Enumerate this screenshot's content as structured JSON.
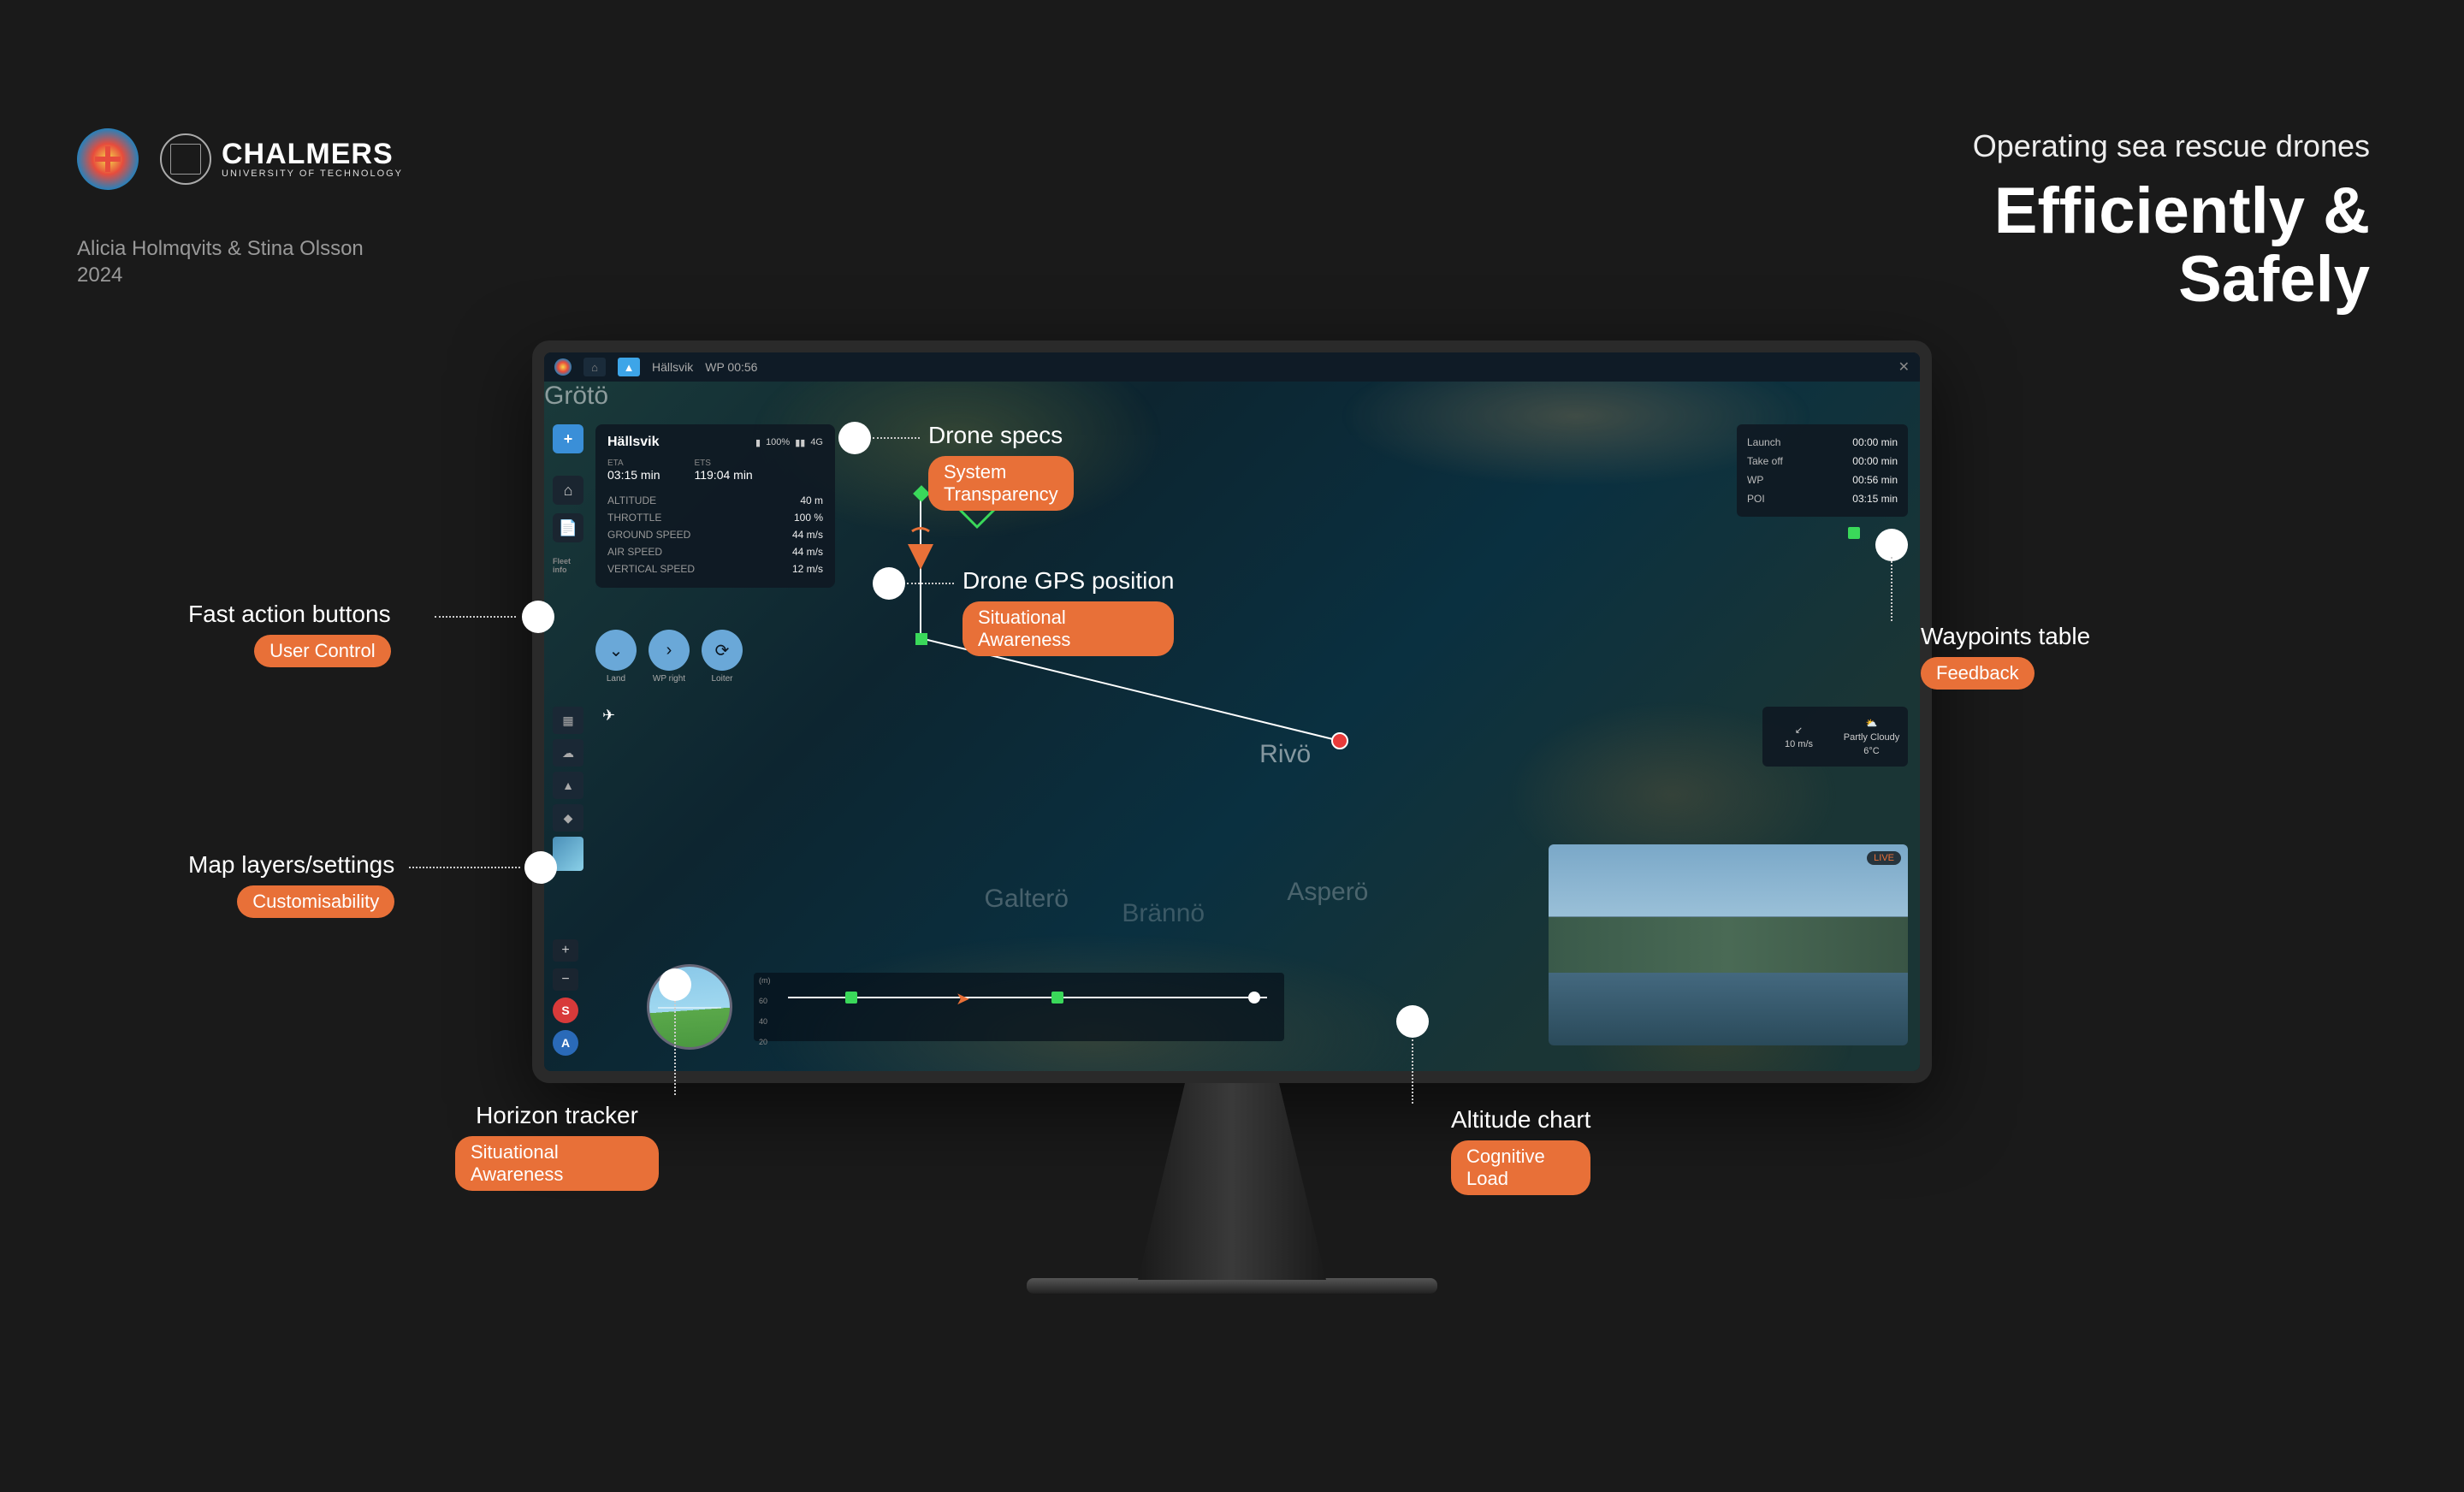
{
  "header": {
    "chalmers": "CHALMERS",
    "chalmers_sub": "UNIVERSITY OF TECHNOLOGY",
    "credits_line1": "Alicia Holmqvits & Stina Olsson",
    "credits_line2": "2024"
  },
  "title": {
    "pre": "Operating sea rescue drones",
    "line1": "Efficiently &",
    "line2": "Safely"
  },
  "titlebar": {
    "home": "Home",
    "location": "Hällsvik",
    "wp": "WP 00:56"
  },
  "specs": {
    "name": "Hällsvik",
    "battery": "100%",
    "signal": "4G",
    "eta_label": "ETA",
    "eta_value": "03:15 min",
    "ets_label": "ETS",
    "ets_value": "119:04 min",
    "rows": [
      {
        "k": "ALTITUDE",
        "v": "40 m"
      },
      {
        "k": "THROTTLE",
        "v": "100 %"
      },
      {
        "k": "GROUND SPEED",
        "v": "44 m/s"
      },
      {
        "k": "AIR SPEED",
        "v": "44 m/s"
      },
      {
        "k": "VERTICAL SPEED",
        "v": "12 m/s"
      }
    ]
  },
  "actions": {
    "land": "Land",
    "wp_right": "WP right",
    "loiter": "Loiter"
  },
  "left_rail": {
    "fleet_info": "Fleet info"
  },
  "waypoints": {
    "rows": [
      {
        "k": "Launch",
        "v": "00:00 min"
      },
      {
        "k": "Take off",
        "v": "00:00 min"
      },
      {
        "k": "WP",
        "v": "00:56 min"
      },
      {
        "k": "POI",
        "v": "03:15 min"
      }
    ]
  },
  "weather": {
    "wind": "10 m/s",
    "cond": "Partly Cloudy",
    "temp": "6°C"
  },
  "camera": {
    "tag": "LIVE"
  },
  "altitude": {
    "unit": "(m)",
    "ticks": [
      "60",
      "40",
      "20"
    ]
  },
  "map_labels": {
    "rivo": "Rivö",
    "galtero": "Galterö",
    "branno": "Brännö",
    "aspero": "Asperö",
    "groto": "Grötö"
  },
  "annotations": {
    "fast_actions": {
      "title": "Fast action buttons",
      "tag": "User Control"
    },
    "map_layers": {
      "title": "Map layers/settings",
      "tag": "Customisability"
    },
    "horizon": {
      "title": "Horizon tracker",
      "tag": "Situational Awareness"
    },
    "specs": {
      "title": "Drone specs",
      "tag": "System Transparency"
    },
    "gps": {
      "title": "Drone GPS position",
      "tag": "Situational Awareness"
    },
    "altitude": {
      "title": "Altitude chart",
      "tag": "Cognitive Load"
    },
    "waypoints": {
      "title": "Waypoints table",
      "tag": "Feedback"
    }
  }
}
